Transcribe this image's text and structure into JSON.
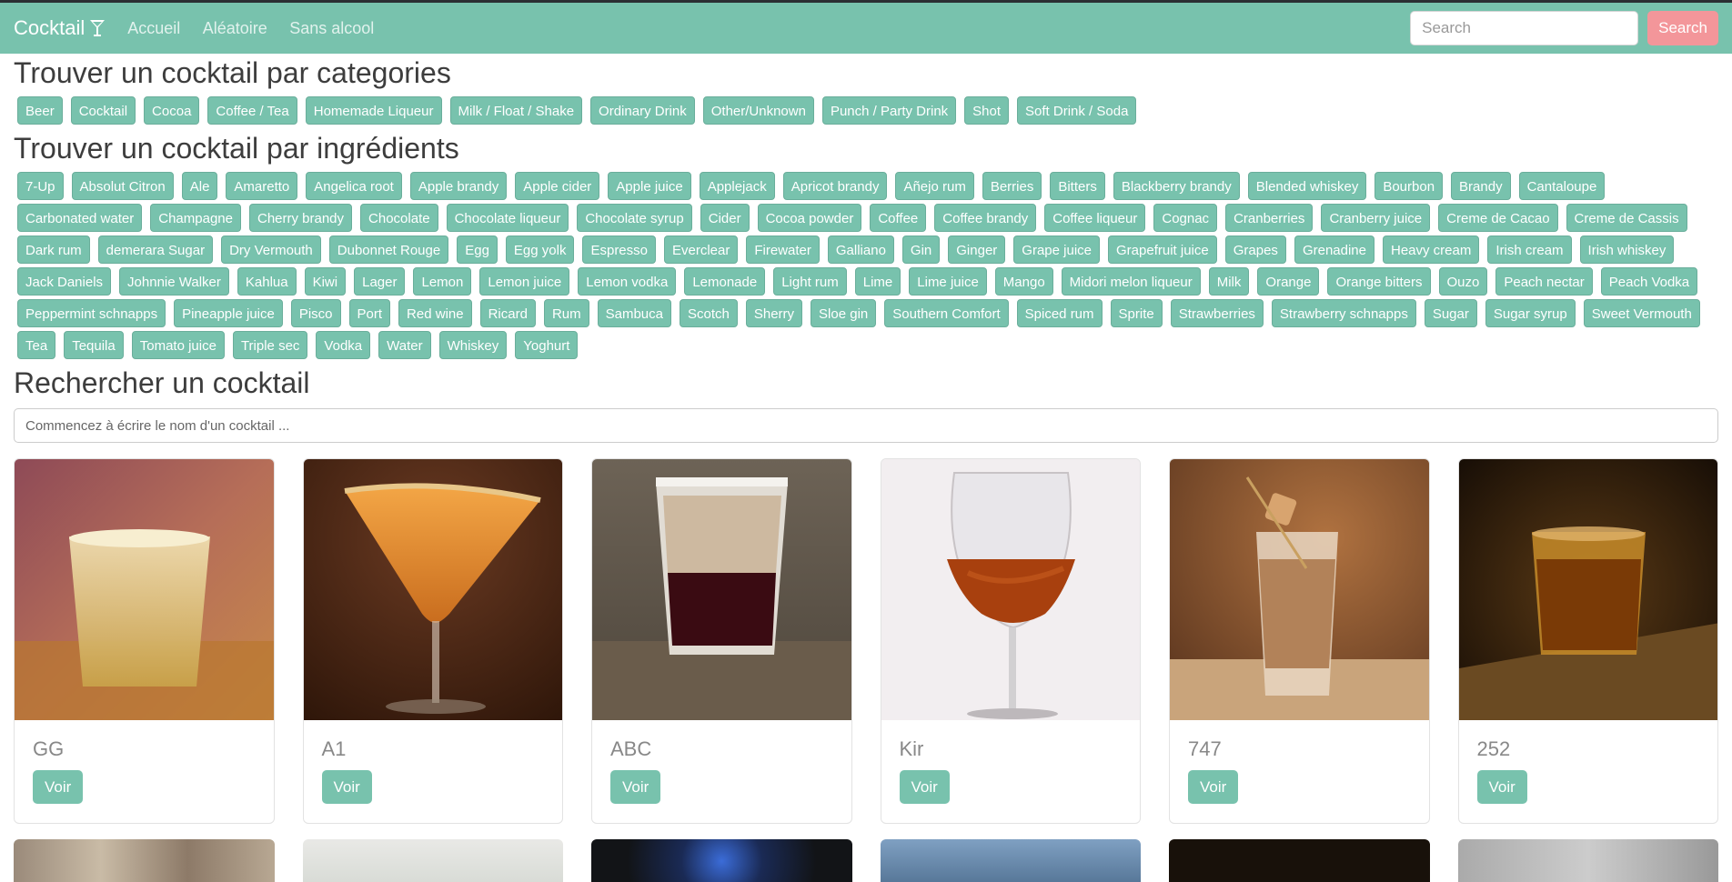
{
  "nav": {
    "brand": "Cocktail",
    "links": [
      "Accueil",
      "Aléatoire",
      "Sans alcool"
    ],
    "search_placeholder": "Search",
    "search_button": "Search"
  },
  "sections": {
    "categories_title": "Trouver un cocktail par categories",
    "ingredients_title": "Trouver un cocktail par ingrédients",
    "search_title": "Rechercher un cocktail",
    "search_placeholder": "Commencez à écrire le nom d'un cocktail ..."
  },
  "categories": [
    "Beer",
    "Cocktail",
    "Cocoa",
    "Coffee / Tea",
    "Homemade Liqueur",
    "Milk / Float / Shake",
    "Ordinary Drink",
    "Other/Unknown",
    "Punch / Party Drink",
    "Shot",
    "Soft Drink / Soda"
  ],
  "ingredients": [
    "7-Up",
    "Absolut Citron",
    "Ale",
    "Amaretto",
    "Angelica root",
    "Apple brandy",
    "Apple cider",
    "Apple juice",
    "Applejack",
    "Apricot brandy",
    "Añejo rum",
    "Berries",
    "Bitters",
    "Blackberry brandy",
    "Blended whiskey",
    "Bourbon",
    "Brandy",
    "Cantaloupe",
    "Carbonated water",
    "Champagne",
    "Cherry brandy",
    "Chocolate",
    "Chocolate liqueur",
    "Chocolate syrup",
    "Cider",
    "Cocoa powder",
    "Coffee",
    "Coffee brandy",
    "Coffee liqueur",
    "Cognac",
    "Cranberries",
    "Cranberry juice",
    "Creme de Cacao",
    "Creme de Cassis",
    "Dark rum",
    "demerara Sugar",
    "Dry Vermouth",
    "Dubonnet Rouge",
    "Egg",
    "Egg yolk",
    "Espresso",
    "Everclear",
    "Firewater",
    "Galliano",
    "Gin",
    "Ginger",
    "Grape juice",
    "Grapefruit juice",
    "Grapes",
    "Grenadine",
    "Heavy cream",
    "Irish cream",
    "Irish whiskey",
    "Jack Daniels",
    "Johnnie Walker",
    "Kahlua",
    "Kiwi",
    "Lager",
    "Lemon",
    "Lemon juice",
    "Lemon vodka",
    "Lemonade",
    "Light rum",
    "Lime",
    "Lime juice",
    "Mango",
    "Midori melon liqueur",
    "Milk",
    "Orange",
    "Orange bitters",
    "Ouzo",
    "Peach nectar",
    "Peach Vodka",
    "Peppermint schnapps",
    "Pineapple juice",
    "Pisco",
    "Port",
    "Red wine",
    "Ricard",
    "Rum",
    "Sambuca",
    "Scotch",
    "Sherry",
    "Sloe gin",
    "Southern Comfort",
    "Spiced rum",
    "Sprite",
    "Strawberries",
    "Strawberry schnapps",
    "Sugar",
    "Sugar syrup",
    "Sweet Vermouth",
    "Tea",
    "Tequila",
    "Tomato juice",
    "Triple sec",
    "Vodka",
    "Water",
    "Whiskey",
    "Yoghurt"
  ],
  "cocktails": [
    {
      "name": "GG",
      "button": "Voir"
    },
    {
      "name": "A1",
      "button": "Voir"
    },
    {
      "name": "ABC",
      "button": "Voir"
    },
    {
      "name": "Kir",
      "button": "Voir"
    },
    {
      "name": "747",
      "button": "Voir"
    },
    {
      "name": "252",
      "button": "Voir"
    }
  ],
  "colors": {
    "primary": "#78c2ad",
    "secondary": "#f3969a"
  }
}
